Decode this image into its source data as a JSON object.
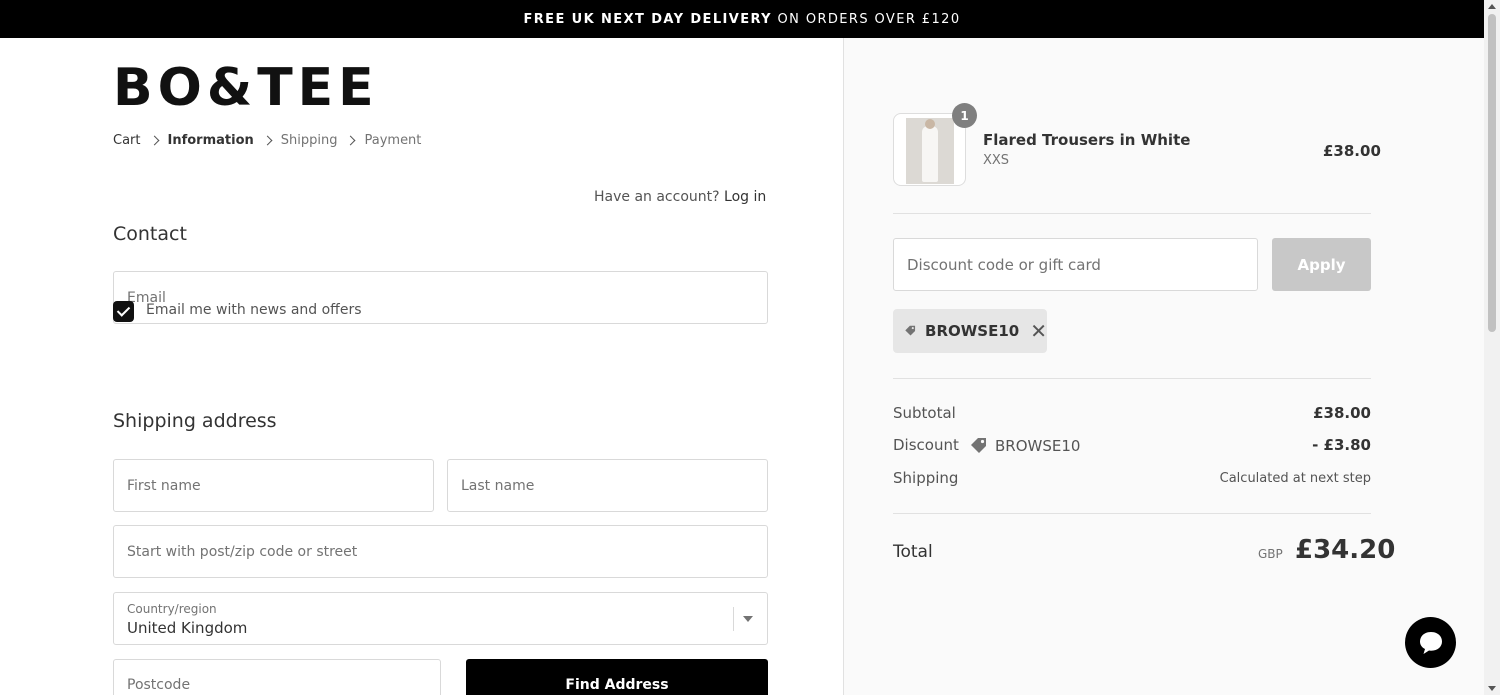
{
  "banner": {
    "bold_text": "FREE UK NEXT DAY DELIVERY",
    "thin_text": " ON ORDERS OVER £120"
  },
  "brand": {
    "logo": "BO&TEE"
  },
  "breadcrumb": {
    "items": [
      "Cart",
      "Information",
      "Shipping",
      "Payment"
    ]
  },
  "contact": {
    "heading": "Contact",
    "account_prompt": "Have an account? ",
    "login_link": "Log in",
    "email_placeholder": "Email",
    "newsletter_label": "Email me with news and offers",
    "newsletter_checked": true
  },
  "shipping": {
    "heading": "Shipping address",
    "first_name_placeholder": "First name",
    "last_name_placeholder": "Last name",
    "address_placeholder": "Start with post/zip code or street",
    "country_label": "Country/region",
    "country_value": "United Kingdom",
    "postcode_placeholder": "Postcode",
    "find_address_label": "Find Address"
  },
  "summary": {
    "product": {
      "name": "Flared Trousers in White",
      "variant": "XXS",
      "price": "£38.00",
      "quantity": "1"
    },
    "discount_placeholder": "Discount code or gift card",
    "apply_label": "Apply",
    "applied_code": "BROWSE10",
    "subtotal_label": "Subtotal",
    "subtotal_value": "£38.00",
    "discount_label": "Discount",
    "discount_code": "BROWSE10",
    "discount_value": "- £3.80",
    "shipping_label": "Shipping",
    "shipping_value": "Calculated at next step",
    "total_label": "Total",
    "currency": "GBP",
    "total_value": "£34.20"
  },
  "colors": {
    "banner_bg": "#000000",
    "accent": "#000000",
    "summary_bg": "#fafafa",
    "apply_disabled": "#c8c8c8"
  }
}
